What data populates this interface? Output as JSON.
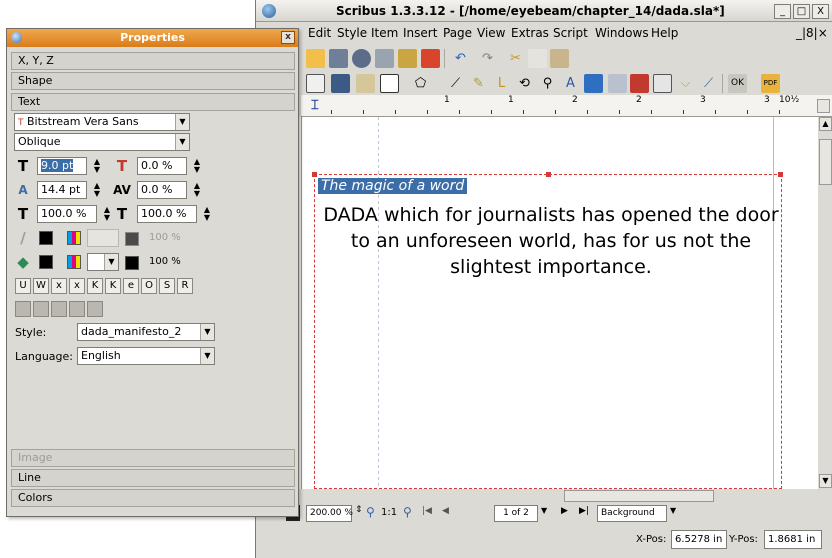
{
  "main_window": {
    "title": "Scribus 1.3.3.12 - [/home/eyebeam/chapter_14/dada.sla*]",
    "controls": {
      "minimize": "_",
      "maximize": "□",
      "close": "X"
    },
    "menu": [
      "Edit",
      "Style",
      "Item",
      "Insert",
      "Page",
      "View",
      "Extras",
      "Script",
      "Windows",
      "Help"
    ],
    "menu_right": "_|8|×",
    "ruler_labels": [
      "1",
      "1",
      "2",
      "2",
      "3",
      "3",
      "10½"
    ]
  },
  "document": {
    "selected_text": "The magic of a word",
    "body_text": "DADA which for journalists has opened the door to an unforeseen world, has for us not the slightest importance."
  },
  "statusbar": {
    "zoom": "200.00 %",
    "zoom_ratio": "1:1",
    "page": "1 of 2",
    "layer": "Background",
    "x_label": "X-Pos:",
    "x_value": "6.5278 in",
    "y_label": "Y-Pos:",
    "y_value": "1.8681 in"
  },
  "properties": {
    "title": "Properties",
    "close": "x",
    "tabs_top": [
      "X, Y, Z",
      "Shape",
      "Text"
    ],
    "font": "Bitstream Vera Sans",
    "style_variant": "Oblique",
    "font_size": "9.0 pt",
    "line_spacing": "14.4 pt",
    "char_width": "100.0 %",
    "baseline_offset": "0.0 %",
    "tracking": "0.0 %",
    "char_height": "100.0 %",
    "stroke_shade": "100 %",
    "fill_shade": "100 %",
    "style_label": "Style:",
    "style_value": "dada_manifesto_2",
    "language_label": "Language:",
    "language_value": "English",
    "tabs_bottom": [
      "Image",
      "Line",
      "Colors"
    ]
  }
}
